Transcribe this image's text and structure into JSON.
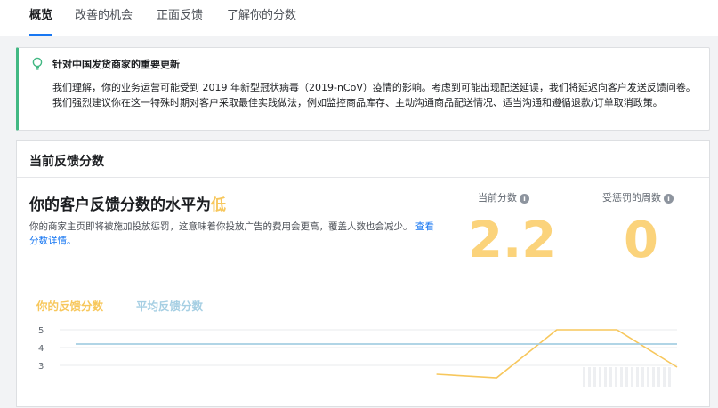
{
  "tabs": [
    {
      "label": "概览",
      "active": true
    },
    {
      "label": "改善的机会",
      "active": false
    },
    {
      "label": "正面反馈",
      "active": false
    },
    {
      "label": "了解你的分数",
      "active": false
    }
  ],
  "notice": {
    "icon": "lightbulb-icon",
    "title": "针对中国发货商家的重要更新",
    "body": "我们理解，你的业务运营可能受到 2019 年新型冠状病毒（2019-nCoV）疫情的影响。考虑到可能出现配送延误，我们将延迟向客户发送反馈问卷。我们强烈建议你在这一特殊时期对客户采取最佳实践做法，例如监控商品库存、主动沟通商品配送情况、适当沟通和遵循退款/订单取消政策。"
  },
  "feedback_card": {
    "title": "当前反馈分数",
    "headline_prefix": "你的客户反馈分数的水平为",
    "headline_level": "低",
    "description": "你的商家主页即将被施加投放惩罚，这意味着你投放广告的费用会更高，覆盖人数也会减少。",
    "details_link": "查看分数详情。",
    "current_score_label": "当前分数",
    "current_score": "2.2",
    "penalty_weeks_label": "受惩罚的周数",
    "penalty_weeks": "0",
    "info_glyph": "i"
  },
  "colors": {
    "accent": "#1877f2",
    "score": "#fbd37b",
    "your_series": "#f7c75c",
    "avg_series": "#a6cfe3",
    "notice_border": "#42b883"
  },
  "chart_data": {
    "type": "line",
    "series": [
      {
        "name": "你的反馈分数",
        "y": [
          null,
          null,
          null,
          null,
          null,
          null,
          2.5,
          2.3,
          5.0,
          5.0,
          2.9
        ]
      },
      {
        "name": "平均反馈分数",
        "y": [
          4.2,
          4.2,
          4.2,
          4.2,
          4.2,
          4.2,
          4.2,
          4.2,
          4.2,
          4.2,
          4.2
        ]
      }
    ],
    "ylim": [
      0,
      5
    ],
    "yticks": [
      3,
      4,
      5
    ],
    "grid": true,
    "legend_position": "top-left"
  }
}
